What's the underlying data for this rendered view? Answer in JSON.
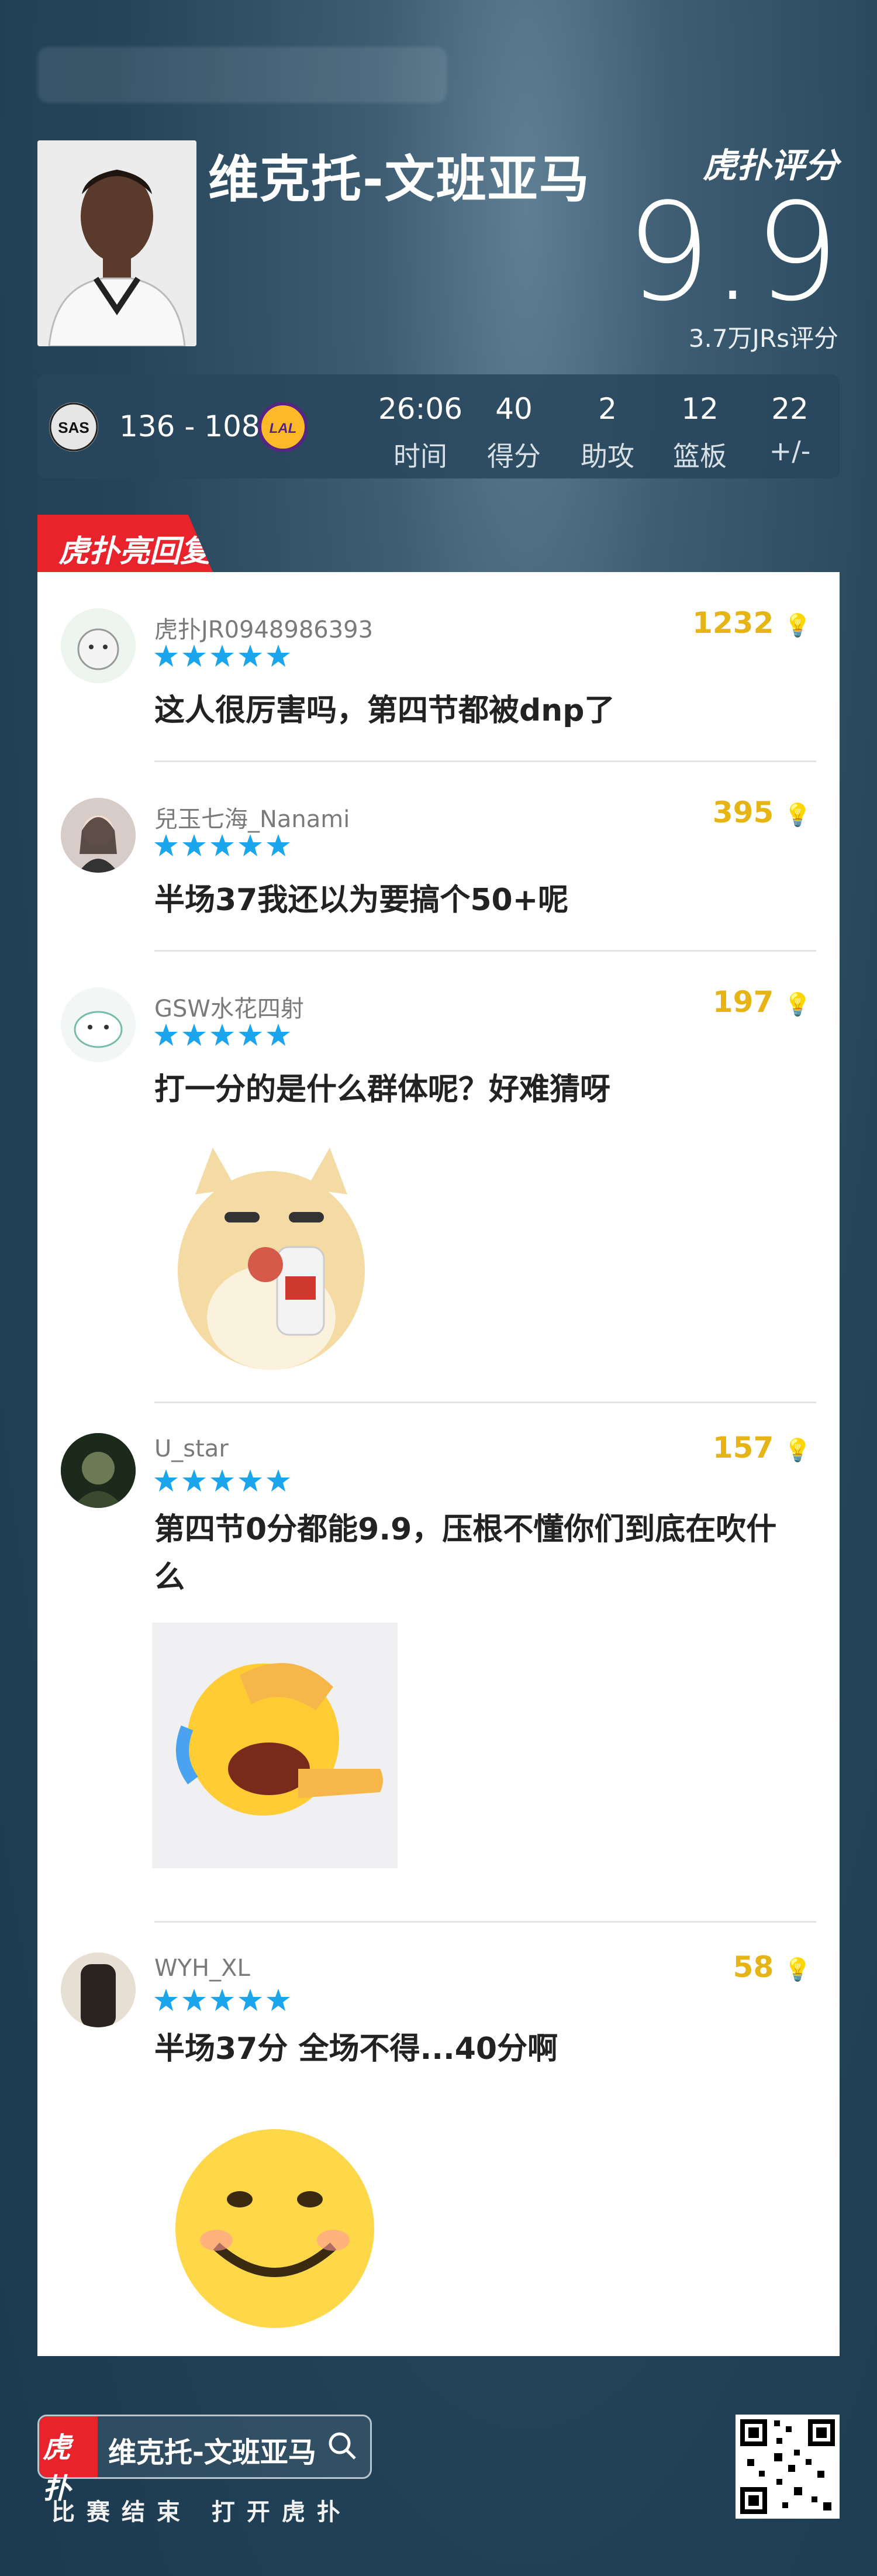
{
  "player": {
    "name": "维克托-文班亚马",
    "rating": "9.9",
    "rating_count": "3.7万JRs评分",
    "brand": "虎扑评分"
  },
  "game": {
    "home_badge": "SAS",
    "away_badge": "LAL",
    "score": "136 - 108",
    "stats": [
      {
        "value": "26:06",
        "label": "时间"
      },
      {
        "value": "40",
        "label": "得分"
      },
      {
        "value": "2",
        "label": "助攻"
      },
      {
        "value": "12",
        "label": "篮板"
      },
      {
        "value": "22",
        "label": "+/-"
      }
    ]
  },
  "section_title": "虎扑亮回复",
  "comments": [
    {
      "user": "虎扑JR0948986393",
      "likes": "1232",
      "stars": 5,
      "text": "这人很厉害吗，第四节都被dnp了"
    },
    {
      "user": "兒玉七海_Nanami",
      "likes": "395",
      "stars": 5,
      "text": "半场37我还以为要搞个50+呢"
    },
    {
      "user": "GSW水花四射",
      "likes": "197",
      "stars": 5,
      "text": "打一分的是什么群体呢？好难猜呀"
    },
    {
      "user": "U_star",
      "likes": "157",
      "stars": 5,
      "text": "第四节0分都能9.9，压根不懂你们到底在吹什么"
    },
    {
      "user": "WYH_XL",
      "likes": "58",
      "stars": 5,
      "text": "半场37分 全场不得...40分啊"
    }
  ],
  "footer": {
    "search_text": "维克托-文班亚马",
    "hint": "比赛结束 打开虎扑",
    "logo_text": "虎扑"
  },
  "colors": {
    "accent_red": "#e8232b",
    "likes_gold": "#e7b416",
    "star_blue": "#1aa5ec"
  }
}
